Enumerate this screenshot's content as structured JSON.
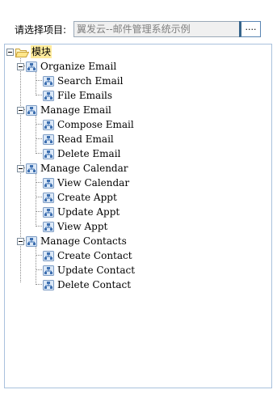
{
  "project": {
    "label": "请选择项目:",
    "value": "翼发云--邮件管理系统示例",
    "browse_label": "...."
  },
  "tree": {
    "root": "模块",
    "groups": [
      {
        "label": "Organize Email",
        "items": [
          "Search Email",
          "File Emails"
        ]
      },
      {
        "label": "Manage Email",
        "items": [
          "Compose Email",
          "Read Email",
          "Delete Email"
        ]
      },
      {
        "label": "Manage Calendar",
        "items": [
          "View Calendar",
          "Create Appt",
          "Update Appt",
          "View Appt"
        ]
      },
      {
        "label": "Manage Contacts",
        "items": [
          "Create Contact",
          "Update Contact",
          "Delete Contact"
        ]
      }
    ]
  },
  "icons": {
    "root_toggle": "collapse-icon",
    "root_icon": "folder-open-icon",
    "group_icon": "hierarchy-icon",
    "item_icon": "hierarchy-icon"
  }
}
